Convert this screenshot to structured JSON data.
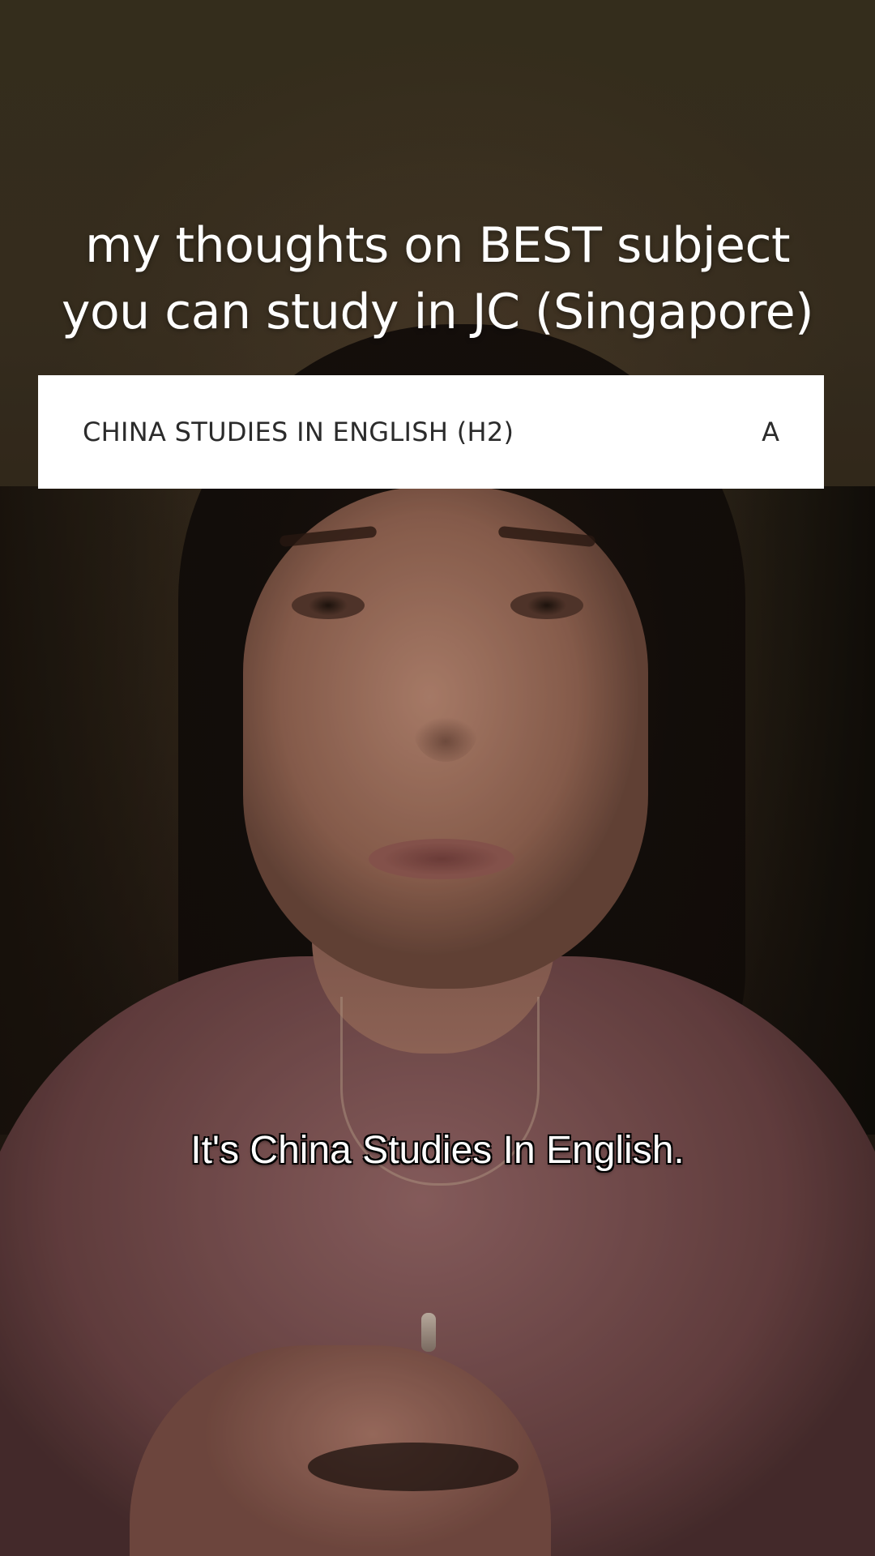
{
  "overlay": {
    "title_line1": "my thoughts on BEST subject",
    "title_line2": "you can study in JC (Singapore)"
  },
  "grade_card": {
    "subject": "CHINA STUDIES IN ENGLISH (H2)",
    "grade": "A"
  },
  "caption": {
    "text": "It's China Studies In English."
  },
  "colors": {
    "card_background": "#ffffff",
    "card_text": "#2b2b2b",
    "title_text": "#ffffff",
    "caption_text": "#ffffff",
    "caption_outline": "#000000"
  }
}
